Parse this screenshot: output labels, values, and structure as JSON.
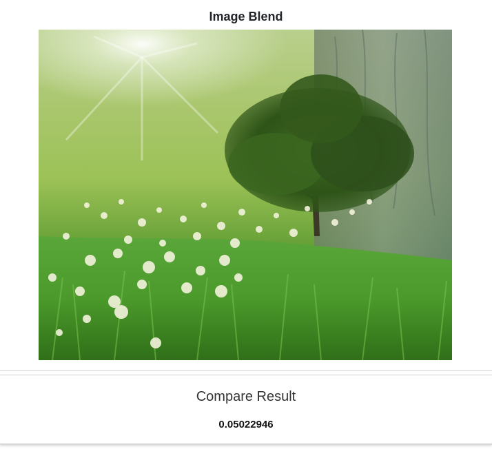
{
  "blend": {
    "title": "Image Blend",
    "image_alt": "Blended image of a tree in a meadow"
  },
  "compare": {
    "title": "Compare Result",
    "value": "0.05022946"
  }
}
